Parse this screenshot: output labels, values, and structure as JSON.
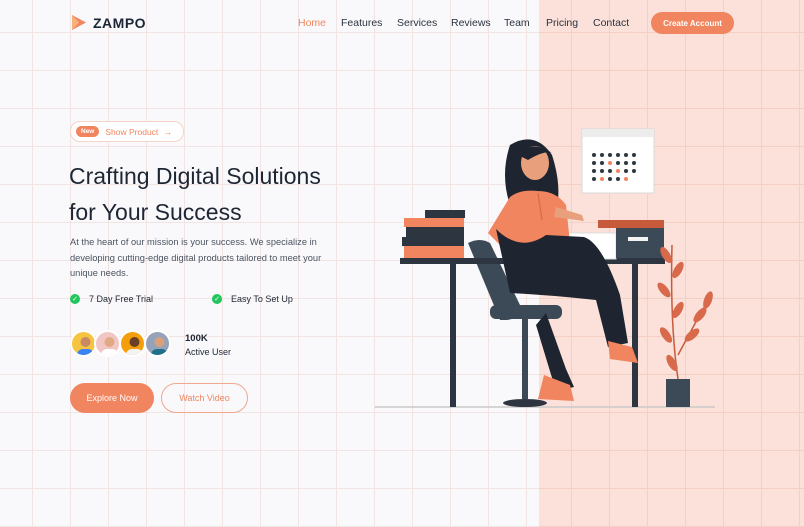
{
  "brand": {
    "name": "ZAMPO",
    "accent": "#f0855f"
  },
  "nav": {
    "items": [
      {
        "label": "Home",
        "active": true
      },
      {
        "label": "Features",
        "active": false
      },
      {
        "label": "Services",
        "active": false
      },
      {
        "label": "Reviews",
        "active": false
      },
      {
        "label": "Team",
        "active": false
      },
      {
        "label": "Pricing",
        "active": false
      },
      {
        "label": "Contact",
        "active": false
      }
    ],
    "cta_label": "Create Account"
  },
  "hero": {
    "badge": "New",
    "pill_text": "Show Product",
    "pill_icon": "arrow-right-icon",
    "headline_line1": "Crafting Digital Solutions",
    "headline_line2": "for Your Success",
    "description": "At the heart of our mission is your success. We specialize in developing cutting-edge digital products tailored to meet your unique needs.",
    "features": [
      "7 Day Free Trial",
      "Easy To Set Up"
    ],
    "users_count": "100K",
    "users_label": "Active User",
    "primary_button": "Explore Now",
    "secondary_button": "Watch Video"
  }
}
